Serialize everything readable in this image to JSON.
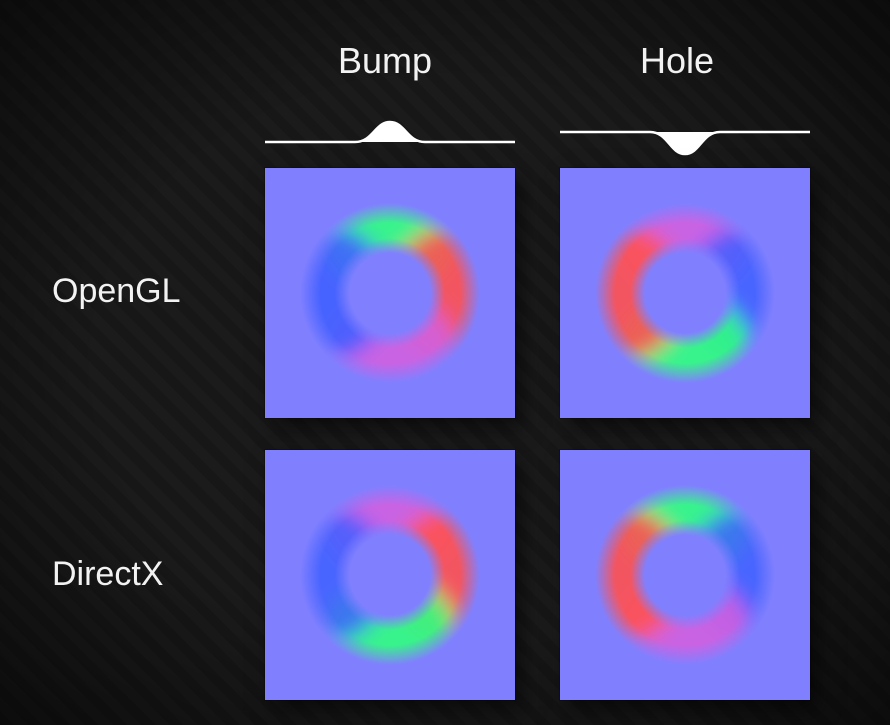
{
  "diagram": {
    "columns": [
      "Bump",
      "Hole"
    ],
    "rows": [
      "OpenGL",
      "DirectX"
    ],
    "flat_normal_color": "#8080ff",
    "cells": [
      {
        "row": "OpenGL",
        "col": "Bump",
        "green_channel_flipped": false,
        "shape": "bump"
      },
      {
        "row": "OpenGL",
        "col": "Hole",
        "green_channel_flipped": false,
        "shape": "hole"
      },
      {
        "row": "DirectX",
        "col": "Bump",
        "green_channel_flipped": true,
        "shape": "bump"
      },
      {
        "row": "DirectX",
        "col": "Hole",
        "green_channel_flipped": true,
        "shape": "hole"
      }
    ],
    "note": "Tangent-space normal map of a radial bump/hole. OpenGL vs DirectX differ only in the sign of the Y (green) channel; bump vs hole inverts both channels. Visually: OpenGL-bump ring has green on top, red on right; DirectX-bump has green on bottom; the 'hole' column swaps to the opposite sides."
  }
}
